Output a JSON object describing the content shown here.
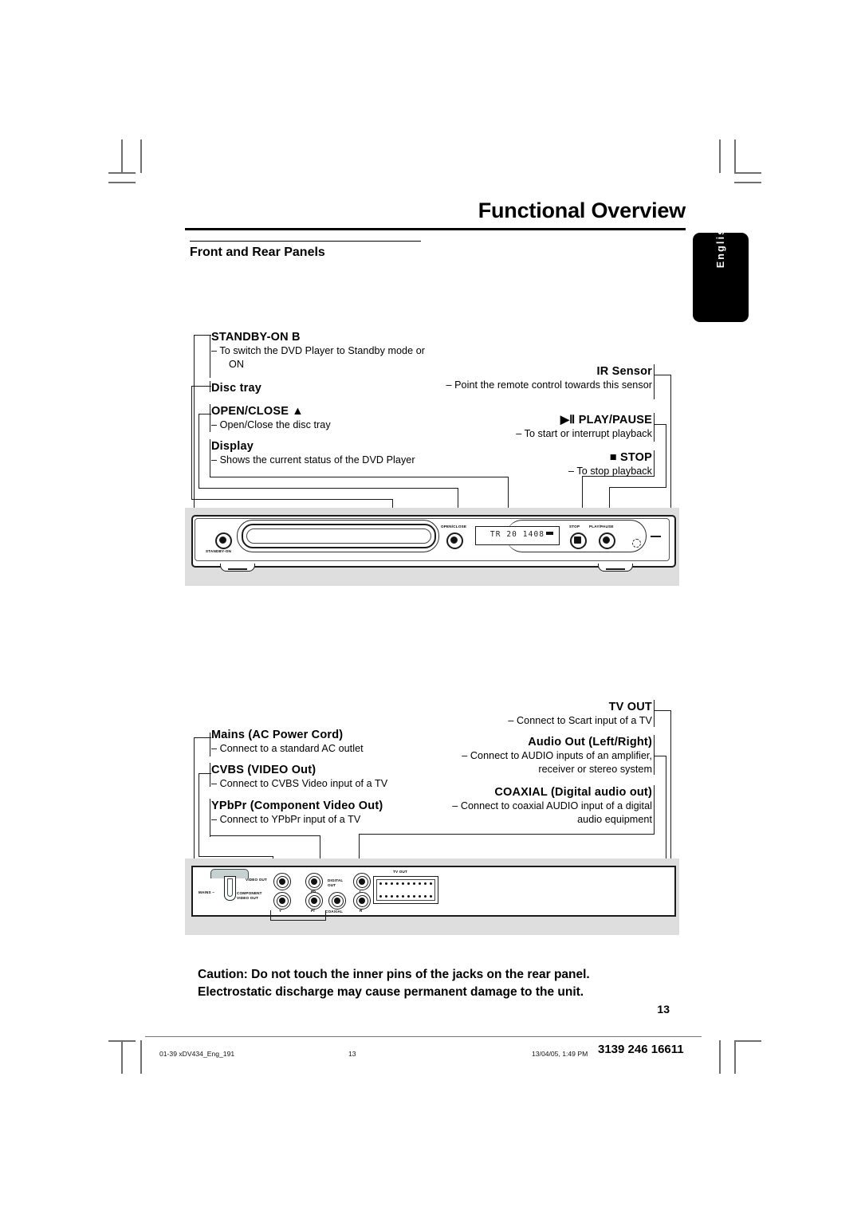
{
  "header": {
    "title": "Functional Overview",
    "section": "Front and Rear Panels"
  },
  "language_tab": {
    "label": "English"
  },
  "front_panel_callouts": {
    "left": [
      {
        "name": "standby-on",
        "heading": "STANDBY-ON B",
        "desc": "–  To switch the DVD Player to Standby mode or ON"
      },
      {
        "name": "disc-tray",
        "heading": "Disc tray",
        "desc": ""
      },
      {
        "name": "open-close",
        "heading": "OPEN/CLOSE ▲",
        "desc": "–  Open/Close the disc tray"
      },
      {
        "name": "display",
        "heading": "Display",
        "desc": "–  Shows the current status of the DVD Player"
      }
    ],
    "right": [
      {
        "name": "ir-sensor",
        "heading": "IR Sensor",
        "desc": "– Point the remote control towards this sensor"
      },
      {
        "name": "play-pause",
        "heading": "▶Ⅱ PLAY/PAUSE",
        "desc": "– To start or interrupt playback"
      },
      {
        "name": "stop",
        "heading": "■  STOP",
        "desc": "– To stop playback"
      }
    ]
  },
  "rear_panel_callouts": {
    "left": [
      {
        "name": "mains",
        "heading": "Mains (AC Power Cord)",
        "desc": "–  Connect to a standard AC outlet"
      },
      {
        "name": "cvbs",
        "heading": "CVBS (VIDEO Out)",
        "desc": "–  Connect to CVBS Video input of a TV"
      },
      {
        "name": "ypbpr",
        "heading": "YPbPr (Component Video Out)",
        "desc": "–  Connect to YPbPr input of a TV"
      }
    ],
    "right": [
      {
        "name": "tv-out",
        "heading": "TV OUT",
        "desc": "– Connect to Scart input of a TV"
      },
      {
        "name": "audio-out",
        "heading": "Audio Out (Left/Right)",
        "desc": "– Connect to AUDIO inputs of an amplifier, receiver or stereo system"
      },
      {
        "name": "coaxial",
        "heading": "COAXIAL (Digital audio out)",
        "desc": "– Connect to coaxial AUDIO input of a digital audio equipment"
      }
    ]
  },
  "front_device": {
    "standby_label": "STANDBY-ON",
    "open_close_label": "OPEN/CLOSE",
    "stop_label": "STOP",
    "play_pause_label": "PLAY/PAUSE",
    "display_text": "TR 20 1408"
  },
  "rear_device": {
    "mains_label": "MAINS ~",
    "video_out_label": "VIDEO OUT",
    "component_video_out_label": "COMPONENT VIDEO OUT",
    "digital_out_label": "DIGITAL OUT",
    "coaxial_label": "COAXIAL",
    "tv_out_label": "TV OUT",
    "pb_label": "Pb",
    "pr_label": "Pr",
    "y_label": "Y",
    "left_label": "L",
    "right_label": "R"
  },
  "caution": {
    "line1": "Caution: Do not touch the inner pins of the jacks on the rear panel.",
    "line2": "Electrostatic discharge may cause permanent damage to the unit."
  },
  "page_number": "13",
  "footer": {
    "file": "01-39 xDV434_Eng_191",
    "page": "13",
    "date": "13/04/05, 1:49 PM",
    "code": "3139 246 16611"
  }
}
